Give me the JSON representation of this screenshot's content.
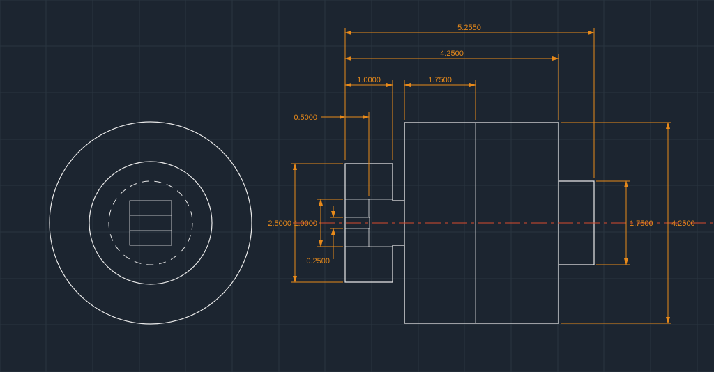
{
  "chart_data": {
    "type": "engineering-drawing",
    "views": [
      "front-circular",
      "side-profile"
    ],
    "dimensions": {
      "overall_length": 5.255,
      "major_diameter": 4.25,
      "shaft_length": 1.75,
      "shaft_extension": 1.0,
      "small_ext": 0.5,
      "bore_depth": 1.0,
      "key_height": 0.25,
      "flange_diameter": 2.5,
      "shaft_diameter": 1.75,
      "bore_diameter_ref": 4.25
    },
    "labels": {
      "d_5_2550": "5.2550",
      "d_4_2500_top": "4.2500",
      "d_1_7500_top": "1.7500",
      "d_1_0000_top": "1.0000",
      "d_0_5000": "0.5000",
      "d_2_5000": "2.5000",
      "d_1_0000_left": "1.0000",
      "d_0_2500": "0.2500",
      "d_1_7500_right": "1.7500",
      "d_4_2500_right": "4.2500"
    }
  }
}
